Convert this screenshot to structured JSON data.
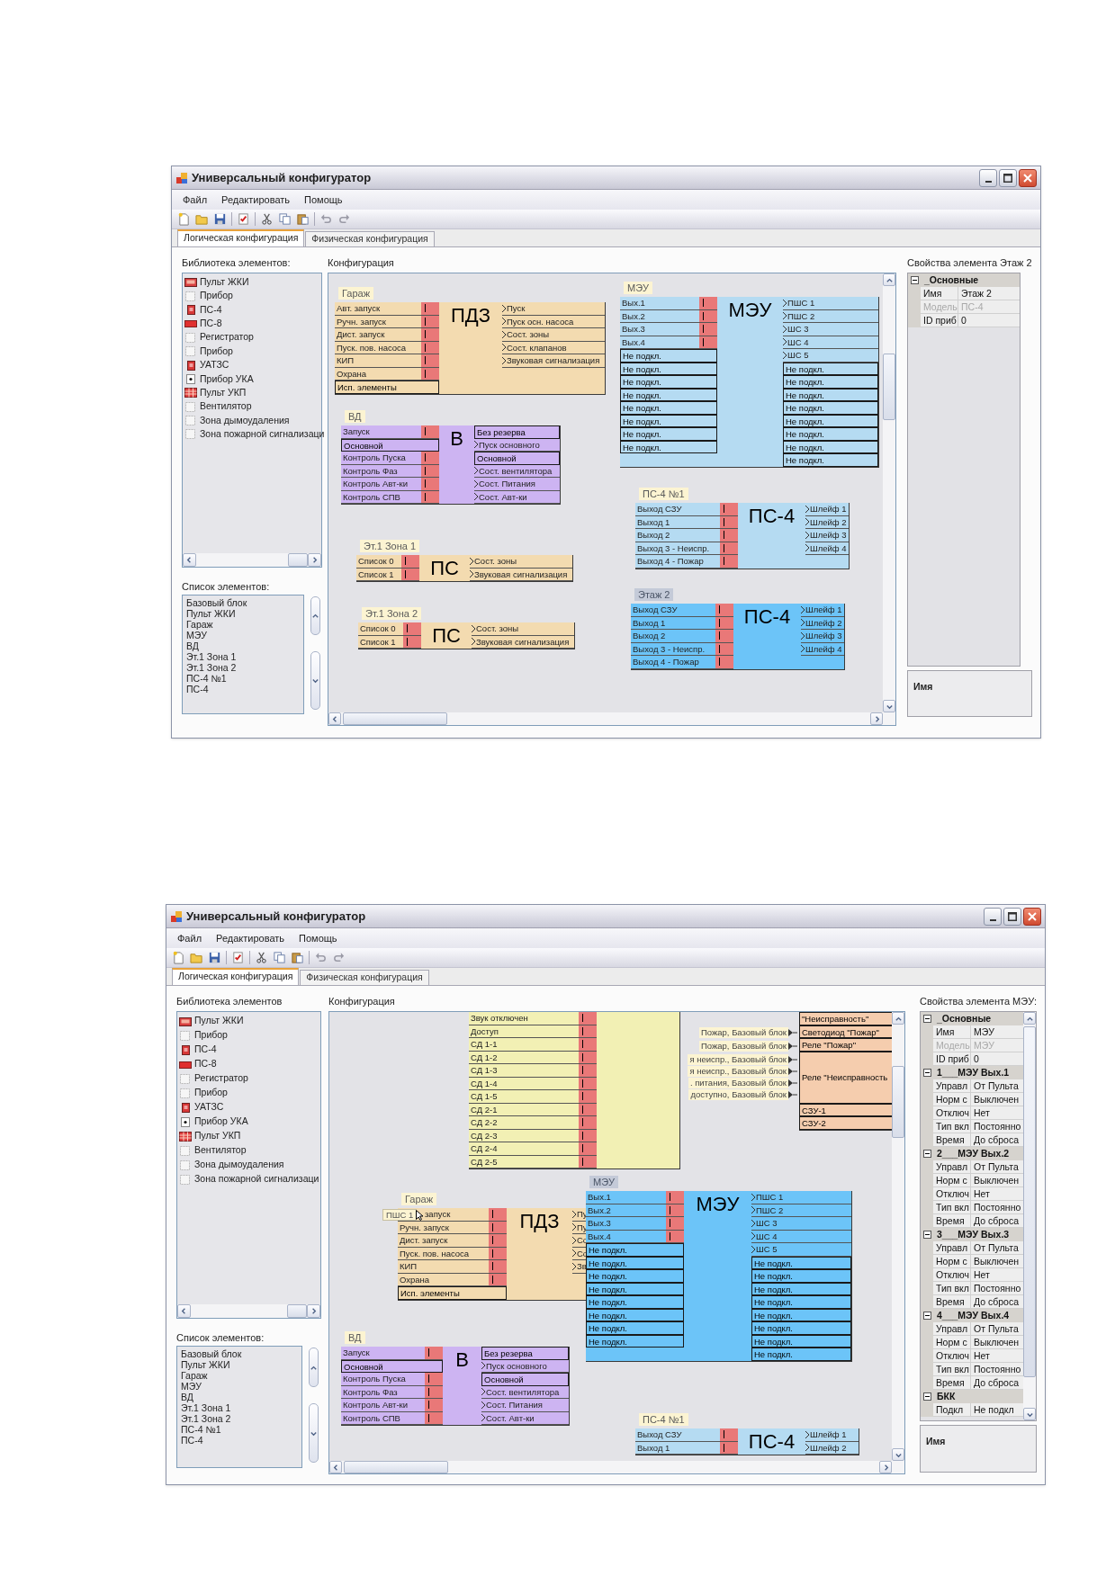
{
  "windows": [
    {
      "title": "Универсальный конфигуратор",
      "menu": [
        "Файл",
        "Редактировать",
        "Помощь"
      ],
      "tabs": [
        {
          "label": "Логическая конфигурация",
          "selected": true
        },
        {
          "label": "Физическая конфигурация",
          "selected": false
        }
      ],
      "library": {
        "label": "Библиотека элементов:",
        "items": [
          {
            "label": "Пульт ЖКИ",
            "kind": "lcd"
          },
          {
            "label": "Прибор",
            "kind": "outline"
          },
          {
            "label": "ПС-4",
            "kind": "red"
          },
          {
            "label": "ПС-8",
            "kind": "red_wide"
          },
          {
            "label": "Регистратор",
            "kind": "outline"
          },
          {
            "label": "Прибор",
            "kind": "outline"
          },
          {
            "label": "УАТЗС",
            "kind": "red"
          },
          {
            "label": "Прибор УКА",
            "kind": "dot"
          },
          {
            "label": "Пульт УКП",
            "kind": "grid"
          },
          {
            "label": "Вентилятор",
            "kind": "outline"
          },
          {
            "label": "Зона дымоудаления",
            "kind": "outline"
          },
          {
            "label": "Зона пожарной сигнализаци",
            "kind": "outline"
          }
        ]
      },
      "elements": {
        "label": "Список элементов:",
        "items": [
          "Базовый блок",
          "Пульт ЖКИ",
          "Гараж",
          "МЭУ",
          "ВД",
          "Эт.1 Зона 1",
          "Эт.1 Зона 2",
          "ПС-4 №1",
          "ПС-4"
        ]
      },
      "canvas": {
        "label": "Конфигурация",
        "blocks": [
          {
            "title": "Гараж",
            "selected": false,
            "color": "#f3dbb0",
            "name": "ПДЗ",
            "inputs": [
              {
                "label": "Авт. запуск",
                "kind": "port"
              },
              {
                "label": "Ручн. запуск",
                "kind": "port"
              },
              {
                "label": "Дист. запуск",
                "kind": "port"
              },
              {
                "label": "Пуск. пов. насоса",
                "kind": "port"
              },
              {
                "label": "КИП",
                "kind": "port"
              },
              {
                "label": "Охрана",
                "kind": "port"
              },
              {
                "label": "Исп. элементы",
                "kind": "plain"
              }
            ],
            "outputs": [
              {
                "label": "Пуск",
                "kind": "port"
              },
              {
                "label": "Пуск осн. насоса",
                "kind": "port"
              },
              {
                "label": "Сост. зоны",
                "kind": "port"
              },
              {
                "label": "Сост. клапанов",
                "kind": "port"
              },
              {
                "label": "Звуковая сигнализация",
                "kind": "port"
              }
            ]
          },
          {
            "title": "ВД",
            "selected": false,
            "color": "#cdb4f2",
            "name": "В",
            "inputs": [
              {
                "label": "Запуск",
                "kind": "port"
              },
              {
                "label": "Основной",
                "kind": "plain"
              },
              {
                "label": "Контроль Пуска",
                "kind": "port"
              },
              {
                "label": "Контроль Фаз",
                "kind": "port"
              },
              {
                "label": "Контроль Авт-ки",
                "kind": "port"
              },
              {
                "label": "Контроль СПВ",
                "kind": "port"
              }
            ],
            "outputs": [
              {
                "label": "Без резерва",
                "kind": "plain"
              },
              {
                "label": "Пуск основного",
                "kind": "port"
              },
              {
                "label": "Основной",
                "kind": "plain"
              },
              {
                "label": "Сост. вентилятора",
                "kind": "port"
              },
              {
                "label": "Сост. Питания",
                "kind": "port"
              },
              {
                "label": "Сост. Авт-ки",
                "kind": "port"
              }
            ]
          },
          {
            "title": "Эт.1 Зона 1",
            "selected": false,
            "color": "#f3dbb0",
            "name": "ПС",
            "inputs": [
              {
                "label": "Список 0",
                "kind": "port"
              },
              {
                "label": "Список 1",
                "kind": "port"
              }
            ],
            "outputs": [
              {
                "label": "Сост. зоны",
                "kind": "port"
              },
              {
                "label": "Звуковая сигнализация",
                "kind": "port"
              }
            ]
          },
          {
            "title": "Эт.1 Зона 2",
            "selected": false,
            "color": "#f3dbb0",
            "name": "ПС",
            "inputs": [
              {
                "label": "Список 0",
                "kind": "port"
              },
              {
                "label": "Список 1",
                "kind": "port"
              }
            ],
            "outputs": [
              {
                "label": "Сост. зоны",
                "kind": "port"
              },
              {
                "label": "Звуковая сигнализация",
                "kind": "port"
              }
            ]
          },
          {
            "title": "МЭУ",
            "selected": false,
            "color": "#b5dbf2",
            "name": "МЭУ",
            "inputs": [
              {
                "label": "Вых.1",
                "kind": "port"
              },
              {
                "label": "Вых.2",
                "kind": "port"
              },
              {
                "label": "Вых.3",
                "kind": "port"
              },
              {
                "label": "Вых.4",
                "kind": "port"
              },
              {
                "label": "Не подкл.",
                "kind": "plain"
              },
              {
                "label": "Не подкл.",
                "kind": "plain"
              },
              {
                "label": "Не подкл.",
                "kind": "plain"
              },
              {
                "label": "Не подкл.",
                "kind": "plain"
              },
              {
                "label": "Не подкл.",
                "kind": "plain"
              },
              {
                "label": "Не подкл.",
                "kind": "plain"
              },
              {
                "label": "Не подкл.",
                "kind": "plain"
              },
              {
                "label": "Не подкл.",
                "kind": "plain"
              }
            ],
            "outputs": [
              {
                "label": "ПШС 1",
                "kind": "port"
              },
              {
                "label": "ПШС 2",
                "kind": "port"
              },
              {
                "label": "ШС 3",
                "kind": "port"
              },
              {
                "label": "ШС 4",
                "kind": "port"
              },
              {
                "label": "ШС 5",
                "kind": "port"
              },
              {
                "label": "Не подкл.",
                "kind": "plain"
              },
              {
                "label": "Не подкл.",
                "kind": "plain"
              },
              {
                "label": "Не подкл.",
                "kind": "plain"
              },
              {
                "label": "Не подкл.",
                "kind": "plain"
              },
              {
                "label": "Не подкл.",
                "kind": "plain"
              },
              {
                "label": "Не подкл.",
                "kind": "plain"
              },
              {
                "label": "Не подкл.",
                "kind": "plain"
              },
              {
                "label": "Не подкл.",
                "kind": "plain"
              }
            ]
          },
          {
            "title": "ПС-4 №1",
            "selected": false,
            "color": "#b5dbf2",
            "name": "ПС-4",
            "inputs": [
              {
                "label": "Выход СЗУ",
                "kind": "port"
              },
              {
                "label": "Выход 1",
                "kind": "port"
              },
              {
                "label": "Выход 2",
                "kind": "port"
              },
              {
                "label": "Выход 3 - Неиспр.",
                "kind": "port"
              },
              {
                "label": "Выход 4 - Пожар",
                "kind": "port"
              }
            ],
            "outputs": [
              {
                "label": "Шлейф 1",
                "kind": "port"
              },
              {
                "label": "Шлейф 2",
                "kind": "port"
              },
              {
                "label": "Шлейф 3",
                "kind": "port"
              },
              {
                "label": "Шлейф 4",
                "kind": "port"
              }
            ]
          },
          {
            "title": "Этаж 2",
            "selected": true,
            "color": "#6cc4f8",
            "name": "ПС-4",
            "inputs": [
              {
                "label": "Выход СЗУ",
                "kind": "port"
              },
              {
                "label": "Выход 1",
                "kind": "port"
              },
              {
                "label": "Выход 2",
                "kind": "port"
              },
              {
                "label": "Выход 3 - Неиспр.",
                "kind": "port"
              },
              {
                "label": "Выход 4 - Пожар",
                "kind": "port"
              }
            ],
            "outputs": [
              {
                "label": "Шлейф 1",
                "kind": "port"
              },
              {
                "label": "Шлейф 2",
                "kind": "port"
              },
              {
                "label": "Шлейф 3",
                "kind": "port"
              },
              {
                "label": "Шлейф 4",
                "kind": "port"
              }
            ]
          }
        ]
      },
      "properties": {
        "label": "Свойства элемента Этаж 2",
        "groups": [
          {
            "name": "_Основные",
            "expanded": true,
            "rows": [
              {
                "key": "Имя",
                "value": "Этаж 2",
                "disabled": false
              },
              {
                "key": "Модель",
                "value": "ПС-4",
                "disabled": true
              },
              {
                "key": "ID приб",
                "value": "0",
                "disabled": false
              }
            ]
          }
        ],
        "help": "Имя"
      }
    },
    {
      "title": "Универсальный конфигуратор",
      "menu": [
        "Файл",
        "Редактировать",
        "Помощь"
      ],
      "tabs": [
        {
          "label": "Логическая конфигурация",
          "selected": true
        },
        {
          "label": "Физическая конфигурация",
          "selected": false
        }
      ],
      "library": {
        "label": "Библиотека элементов",
        "items": [
          {
            "label": "Пульт ЖКИ",
            "kind": "lcd"
          },
          {
            "label": "Прибор",
            "kind": "outline"
          },
          {
            "label": "ПС-4",
            "kind": "red"
          },
          {
            "label": "ПС-8",
            "kind": "red_wide"
          },
          {
            "label": "Регистратор",
            "kind": "outline"
          },
          {
            "label": "Прибор",
            "kind": "outline"
          },
          {
            "label": "УАТЗС",
            "kind": "red"
          },
          {
            "label": "Прибор УКА",
            "kind": "dot"
          },
          {
            "label": "Пульт УКП",
            "kind": "grid"
          },
          {
            "label": "Вентилятор",
            "kind": "outline"
          },
          {
            "label": "Зона дымоудаления",
            "kind": "outline"
          },
          {
            "label": "Зона пожарной сигнализаци",
            "kind": "outline"
          }
        ]
      },
      "elements": {
        "label": "Список элементов:",
        "items": [
          "Базовый блок",
          "Пульт ЖКИ",
          "Гараж",
          "МЭУ",
          "ВД",
          "Эт.1 Зона 1",
          "Эт.1 Зона 2",
          "ПС-4 №1",
          "ПС-4"
        ]
      },
      "canvas": {
        "label": "Конфигурация",
        "links": [
          "Пожар, Базовый блок",
          "Пожар, Базовый блок",
          "я неиспр., Базовый блок",
          "я неиспр., Базовый блок",
          ". питания, Базовый блок",
          "доступно, Базовый блок"
        ],
        "blocks": [
          {
            "selected": false,
            "color": "#f2f0b4",
            "inputs": [
              {
                "label": "Звук отключен",
                "kind": "port"
              },
              {
                "label": "Доступ",
                "kind": "port"
              },
              {
                "label": "СД 1-1",
                "kind": "port"
              },
              {
                "label": "СД 1-2",
                "kind": "port"
              },
              {
                "label": "СД 1-3",
                "kind": "port"
              },
              {
                "label": "СД 1-4",
                "kind": "port"
              },
              {
                "label": "СД 1-5",
                "kind": "port"
              },
              {
                "label": "СД 2-1",
                "kind": "port"
              },
              {
                "label": "СД 2-2",
                "kind": "port"
              },
              {
                "label": "СД 2-3",
                "kind": "port"
              },
              {
                "label": "СД 2-4",
                "kind": "port"
              },
              {
                "label": "СД 2-5",
                "kind": "port"
              }
            ]
          },
          {
            "selected": false,
            "color": "#f5cdae",
            "inputs": [
              {
                "label": "\"Неисправность\"",
                "kind": "plain"
              },
              {
                "label": "Светодиод \"Пожар\"",
                "kind": "plain"
              },
              {
                "label": "Реле \"Пожар\"",
                "kind": "plain"
              },
              {
                "label": "Реле \"Неисправность",
                "kind": "tall"
              },
              {
                "label": "СЗУ-1",
                "kind": "plain"
              },
              {
                "label": "СЗУ-2",
                "kind": "plain"
              }
            ]
          },
          {
            "title": "Гараж",
            "selected": false,
            "color": "#f3dbb0",
            "name": "ПДЗ",
            "inputs": [
              {
                "label": "запуск",
                "kind": "port",
                "tooltip": "ПШС 1"
              },
              {
                "label": "Ручн. запуск",
                "kind": "port"
              },
              {
                "label": "Дист. запуск",
                "kind": "port"
              },
              {
                "label": "Пуск. пов. насоса",
                "kind": "port"
              },
              {
                "label": "КИП",
                "kind": "port"
              },
              {
                "label": "Охрана",
                "kind": "port"
              },
              {
                "label": "Исп. элементы",
                "kind": "plain"
              }
            ],
            "outputs": [
              {
                "label": "Пу",
                "kind": "port"
              },
              {
                "label": "Пу",
                "kind": "port"
              },
              {
                "label": "Со",
                "kind": "port"
              },
              {
                "label": "Со",
                "kind": "port"
              },
              {
                "label": "Зв",
                "kind": "port"
              }
            ]
          },
          {
            "title": "МЭУ",
            "selected": true,
            "color": "#6cc4f8",
            "name": "МЭУ",
            "inputs": [
              {
                "label": "Вых.1",
                "kind": "port"
              },
              {
                "label": "Вых.2",
                "kind": "port"
              },
              {
                "label": "Вых.3",
                "kind": "port"
              },
              {
                "label": "Вых.4",
                "kind": "port"
              },
              {
                "label": "Не подкл.",
                "kind": "plain"
              },
              {
                "label": "Не подкл.",
                "kind": "plain"
              },
              {
                "label": "Не подкл.",
                "kind": "plain"
              },
              {
                "label": "Не подкл.",
                "kind": "plain"
              },
              {
                "label": "Не подкл.",
                "kind": "plain"
              },
              {
                "label": "Не подкл.",
                "kind": "plain"
              },
              {
                "label": "Не подкл.",
                "kind": "plain"
              },
              {
                "label": "Не подкл.",
                "kind": "plain"
              }
            ],
            "outputs": [
              {
                "label": "ПШС 1",
                "kind": "port"
              },
              {
                "label": "ПШС 2",
                "kind": "port"
              },
              {
                "label": "ШС 3",
                "kind": "port"
              },
              {
                "label": "ШС 4",
                "kind": "port"
              },
              {
                "label": "ШС 5",
                "kind": "port"
              },
              {
                "label": "Не подкл.",
                "kind": "plain"
              },
              {
                "label": "Не подкл.",
                "kind": "plain"
              },
              {
                "label": "Не подкл.",
                "kind": "plain"
              },
              {
                "label": "Не подкл.",
                "kind": "plain"
              },
              {
                "label": "Не подкл.",
                "kind": "plain"
              },
              {
                "label": "Не подкл.",
                "kind": "plain"
              },
              {
                "label": "Не подкл.",
                "kind": "plain"
              },
              {
                "label": "Не подкл.",
                "kind": "plain"
              }
            ]
          },
          {
            "title": "ВД",
            "selected": false,
            "color": "#cdb4f2",
            "name": "В",
            "inputs": [
              {
                "label": "Запуск",
                "kind": "port"
              },
              {
                "label": "Основной",
                "kind": "plain"
              },
              {
                "label": "Контроль Пуска",
                "kind": "port"
              },
              {
                "label": "Контроль Фаз",
                "kind": "port"
              },
              {
                "label": "Контроль Авт-ки",
                "kind": "port"
              },
              {
                "label": "Контроль СПВ",
                "kind": "port"
              }
            ],
            "outputs": [
              {
                "label": "Без резерва",
                "kind": "plain"
              },
              {
                "label": "Пуск основного",
                "kind": "port"
              },
              {
                "label": "Основной",
                "kind": "plain"
              },
              {
                "label": "Сост. вентилятора",
                "kind": "port"
              },
              {
                "label": "Сост. Питания",
                "kind": "port"
              },
              {
                "label": "Сост. Авт-ки",
                "kind": "port"
              }
            ]
          },
          {
            "title": "ПС-4 №1",
            "selected": false,
            "color": "#b5dbf2",
            "name": "ПС-4",
            "inputs": [
              {
                "label": "Выход СЗУ",
                "kind": "port"
              },
              {
                "label": "Выход 1",
                "kind": "port"
              }
            ],
            "outputs": [
              {
                "label": "Шлейф 1",
                "kind": "port"
              },
              {
                "label": "Шлейф 2",
                "kind": "port"
              }
            ]
          }
        ]
      },
      "properties": {
        "label": "Свойства элемента МЭУ:",
        "groups": [
          {
            "name": "_Основные",
            "expanded": true,
            "rows": [
              {
                "key": "Имя",
                "value": "МЭУ",
                "disabled": false
              },
              {
                "key": "Модель",
                "value": "МЭУ",
                "disabled": true
              },
              {
                "key": "ID приб",
                "value": "0",
                "disabled": false
              }
            ]
          },
          {
            "name": "1___МЭУ Вых.1",
            "expanded": true,
            "rows": [
              {
                "key": "Управл",
                "value": "От Пульта",
                "disabled": false
              },
              {
                "key": "Норм с",
                "value": "Выключен",
                "disabled": false
              },
              {
                "key": "Отключ",
                "value": "Нет",
                "disabled": false
              },
              {
                "key": "Тип вкл",
                "value": "Постоянно",
                "disabled": false
              },
              {
                "key": "Время",
                "value": "До сброса",
                "disabled": false
              }
            ]
          },
          {
            "name": "2___МЭУ Вых.2",
            "expanded": true,
            "rows": [
              {
                "key": "Управл",
                "value": "От Пульта",
                "disabled": false
              },
              {
                "key": "Норм с",
                "value": "Выключен",
                "disabled": false
              },
              {
                "key": "Отключ",
                "value": "Нет",
                "disabled": false
              },
              {
                "key": "Тип вкл",
                "value": "Постоянно",
                "disabled": false
              },
              {
                "key": "Время",
                "value": "До сброса",
                "disabled": false
              }
            ]
          },
          {
            "name": "3___МЭУ Вых.3",
            "expanded": true,
            "rows": [
              {
                "key": "Управл",
                "value": "От Пульта",
                "disabled": false
              },
              {
                "key": "Норм с",
                "value": "Выключен",
                "disabled": false
              },
              {
                "key": "Отключ",
                "value": "Нет",
                "disabled": false
              },
              {
                "key": "Тип вкл",
                "value": "Постоянно",
                "disabled": false
              },
              {
                "key": "Время",
                "value": "До сброса",
                "disabled": false
              }
            ]
          },
          {
            "name": "4___МЭУ Вых.4",
            "expanded": true,
            "rows": [
              {
                "key": "Управл",
                "value": "От Пульта",
                "disabled": false
              },
              {
                "key": "Норм с",
                "value": "Выключен",
                "disabled": false
              },
              {
                "key": "Отключ",
                "value": "Нет",
                "disabled": false
              },
              {
                "key": "Тип вкл",
                "value": "Постоянно",
                "disabled": false
              },
              {
                "key": "Время",
                "value": "До сброса",
                "disabled": false
              }
            ]
          },
          {
            "name": "БКК",
            "expanded": true,
            "rows": [
              {
                "key": "Подкл",
                "value": "Не подкл",
                "disabled": false
              }
            ]
          }
        ],
        "help": "Имя"
      }
    }
  ]
}
